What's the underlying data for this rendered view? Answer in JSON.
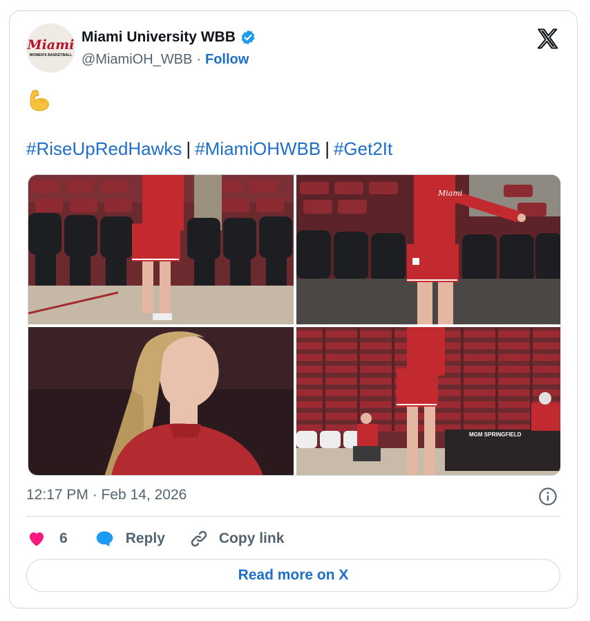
{
  "account": {
    "avatar_text_top": "Miami",
    "avatar_text_bottom": "WOMEN'S BASKETBALL",
    "name": "Miami University WBB",
    "handle": "@MiamiOH_WBB",
    "separator": "·",
    "follow_label": "Follow"
  },
  "tweet": {
    "emoji": "flexed-biceps",
    "hashtags": [
      "#RiseUpRedHawks",
      "#MiamiOHWBB",
      "#Get2It"
    ],
    "pipe": "|"
  },
  "media": {
    "photos": [
      {
        "desc": "player-warmup-courtside-chairs"
      },
      {
        "desc": "player-in-miami-shirt-arm-extended"
      },
      {
        "desc": "player-profile-portrait"
      },
      {
        "desc": "player-jumping-empty-arena"
      }
    ],
    "arena_sign": "MGM SPRINGFIELD",
    "shirt_text": "Miami"
  },
  "meta": {
    "timestamp": "12:17 PM · Feb 14, 2026"
  },
  "actions": {
    "like_count": "6",
    "reply_label": "Reply",
    "copy_label": "Copy link"
  },
  "footer": {
    "read_more_label": "Read more on X"
  },
  "colors": {
    "link": "#1d6fc7",
    "like": "#f91880",
    "verified": "#1d9bf0",
    "muted": "#536471",
    "miami_red": "#c3142d"
  }
}
